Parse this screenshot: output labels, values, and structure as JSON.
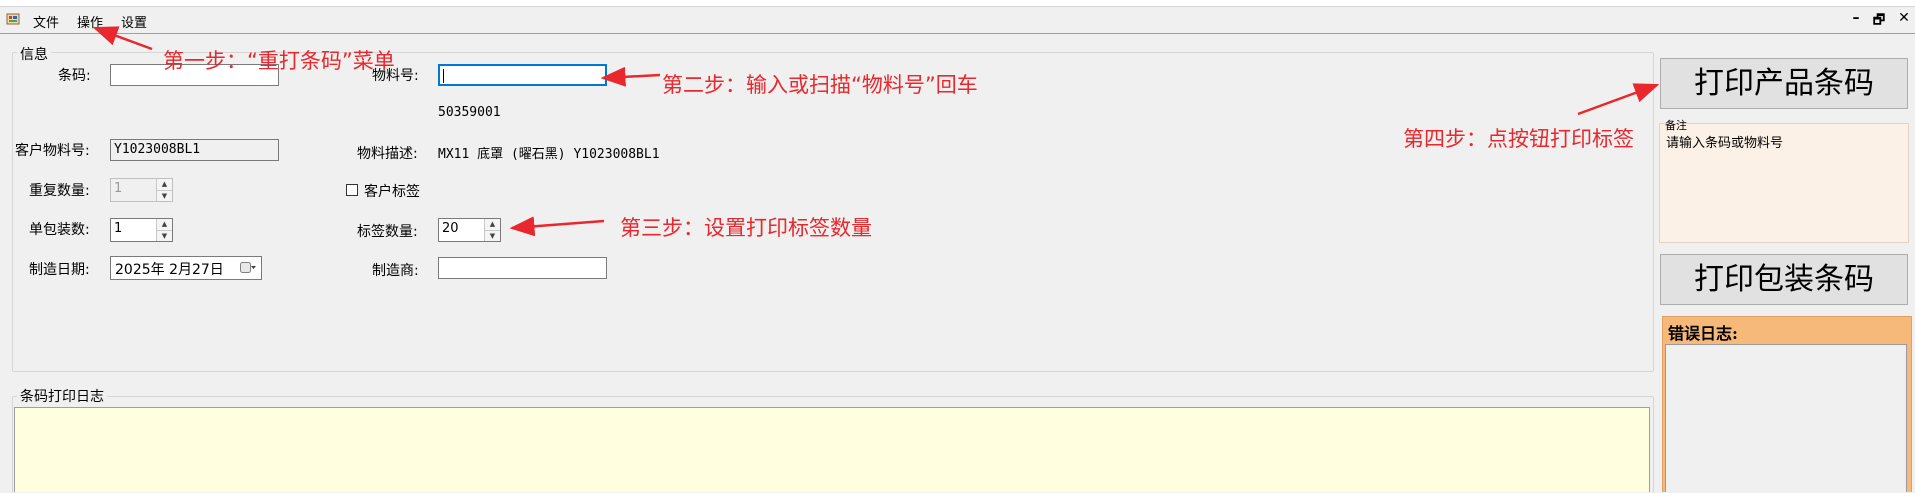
{
  "menu": {
    "file": "文件",
    "operate": "操作",
    "settings": "设置"
  },
  "window_controls": {
    "minimize": "–",
    "restore": "🗗",
    "close": "✕"
  },
  "info_group": {
    "title": "信息",
    "barcode": {
      "label": "条码:",
      "value": ""
    },
    "material_no": {
      "label": "物料号:",
      "value": "",
      "code": "50359001"
    },
    "customer_material_no": {
      "label": "客户物料号:",
      "value": "Y1023008BL1"
    },
    "material_desc": {
      "label": "物料描述:",
      "value": "MX11 底罩 (曜石黑) Y1023008BL1"
    },
    "repeat_qty": {
      "label": "重复数量:",
      "value": "1"
    },
    "customer_label": {
      "label": "客户标签",
      "checked": false
    },
    "pack_qty": {
      "label": "单包装数:",
      "value": "1"
    },
    "label_qty": {
      "label": "标签数量:",
      "value": "20"
    },
    "mfg_date": {
      "label": "制造日期:",
      "value": "2025年  2月27日"
    },
    "manufacturer": {
      "label": "制造商:",
      "value": ""
    }
  },
  "log_group": {
    "title": "条码打印日志"
  },
  "right_panel": {
    "print_product_button": "打印产品条码",
    "note_label": "备注",
    "note_text": "请输入条码或物料号",
    "print_package_button": "打印包装条码",
    "error_log_title": "错误日志:"
  },
  "annotations": {
    "step1": "第一步：“重打条码”菜单",
    "step2": "第二步：输入或扫描“物料号”回车",
    "step3": "第三步：设置打印标签数量",
    "step4": "第四步：点按钮打印标签"
  },
  "colors": {
    "annotation": "#e8282d",
    "focus_border": "#0078d7",
    "log_bg": "#ffffe0",
    "note_bg": "#fbf1e6",
    "error_header_bg": "#f7b97a"
  }
}
